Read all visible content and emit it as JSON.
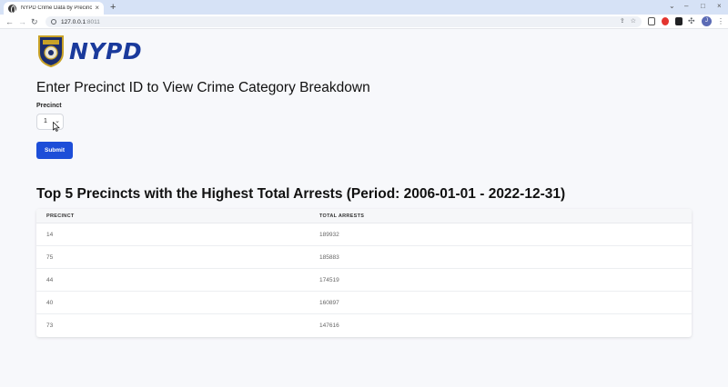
{
  "browser": {
    "tab_title": "NYPD Crime Data by Precincts &",
    "new_tab": "+",
    "url_host": "127.0.0.1",
    "url_port": ":8011",
    "avatar_initial": "J"
  },
  "logo": {
    "wordmark": "NYPD"
  },
  "form": {
    "heading": "Enter Precinct ID to View Crime Category Breakdown",
    "precinct_label": "Precinct",
    "precinct_value": "1",
    "submit_label": "Submit"
  },
  "top_precincts": {
    "title": "Top 5 Precincts with the Highest Total Arrests (Period: 2006-01-01 - 2022-12-31)",
    "columns": [
      "PRECINCT",
      "TOTAL ARRESTS"
    ],
    "rows": [
      {
        "precinct": "14",
        "arrests": "189932"
      },
      {
        "precinct": "75",
        "arrests": "185883"
      },
      {
        "precinct": "44",
        "arrests": "174519"
      },
      {
        "precinct": "40",
        "arrests": "160897"
      },
      {
        "precinct": "73",
        "arrests": "147616"
      }
    ]
  },
  "colors": {
    "accent": "#1d4ed8",
    "logo_blue": "#1a3a9c",
    "tabstrip": "#d6e2f6"
  }
}
